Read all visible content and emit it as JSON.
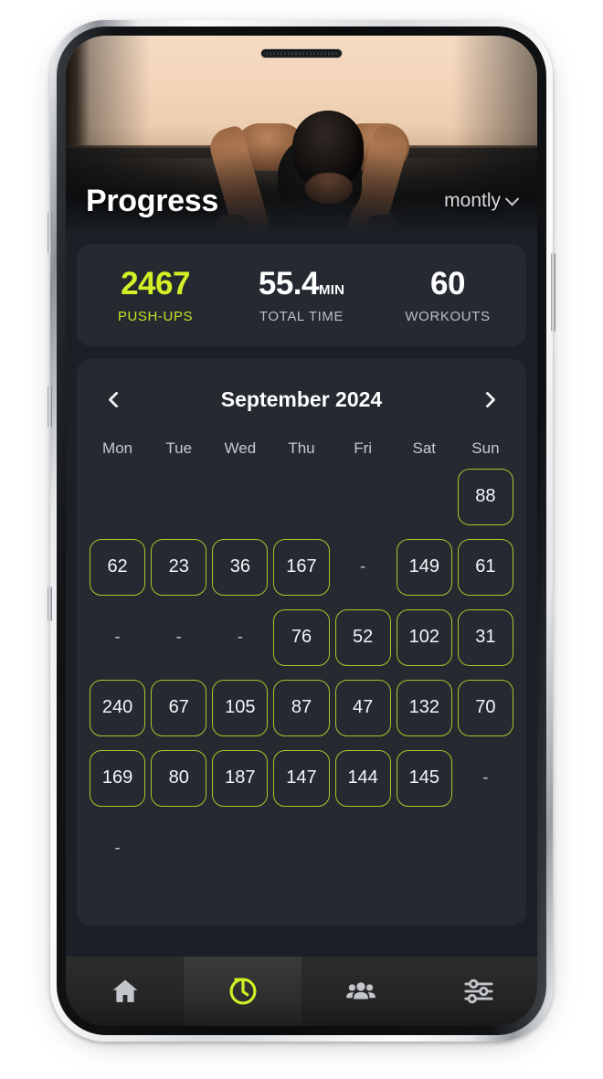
{
  "header": {
    "title": "Progress",
    "period_label": "montly",
    "period_icon": "chevron-down-icon"
  },
  "stats": [
    {
      "value": "2467",
      "unit": "",
      "label": "PUSH-UPS",
      "accent": true
    },
    {
      "value": "55.4",
      "unit": "MIN",
      "label": "TOTAL TIME",
      "accent": false
    },
    {
      "value": "60",
      "unit": "",
      "label": "WORKOUTS",
      "accent": false
    }
  ],
  "calendar": {
    "title": "September 2024",
    "prev_icon": "chevron-left-icon",
    "next_icon": "chevron-right-icon",
    "weekdays": [
      "Mon",
      "Tue",
      "Wed",
      "Thu",
      "Fri",
      "Sat",
      "Sun"
    ],
    "empty_marker": "-",
    "weeks": [
      [
        "",
        "",
        "",
        "",
        "",
        "",
        "88"
      ],
      [
        "62",
        "23",
        "36",
        "167",
        "-",
        "149",
        "61"
      ],
      [
        "-",
        "-",
        "-",
        "76",
        "52",
        "102",
        "31"
      ],
      [
        "240",
        "67",
        "105",
        "87",
        "47",
        "132",
        "70"
      ],
      [
        "169",
        "80",
        "187",
        "147",
        "144",
        "145",
        "-"
      ],
      [
        "-",
        "",
        "",
        "",
        "",
        "",
        ""
      ]
    ]
  },
  "bottom_nav": [
    {
      "icon": "home-icon",
      "active": false
    },
    {
      "icon": "history-clock-icon",
      "active": true
    },
    {
      "icon": "people-group-icon",
      "active": false
    },
    {
      "icon": "sliders-settings-icon",
      "active": false
    }
  ],
  "colors": {
    "accent": "#d3ef25",
    "cell_border": "#aac52a",
    "page_bg": "#1b2026",
    "card_bg": "#252a31",
    "nav_bg": "#2c2c2c"
  }
}
